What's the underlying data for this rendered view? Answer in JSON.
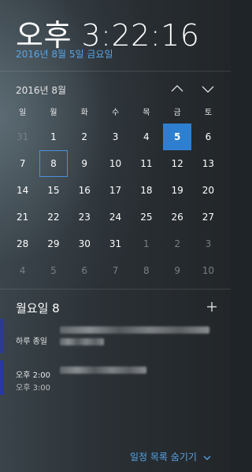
{
  "clock": {
    "time": "오후 3:22:16"
  },
  "date_link": "2016년 8월 5일 금요일",
  "calendar": {
    "month_label": "2016년 8월",
    "weekdays": [
      "일",
      "월",
      "화",
      "수",
      "목",
      "금",
      "토"
    ],
    "weeks": [
      [
        "31",
        "1",
        "2",
        "3",
        "4",
        "5",
        "6"
      ],
      [
        "7",
        "8",
        "9",
        "10",
        "11",
        "12",
        "13"
      ],
      [
        "14",
        "15",
        "16",
        "17",
        "18",
        "19",
        "20"
      ],
      [
        "21",
        "22",
        "23",
        "24",
        "25",
        "26",
        "27"
      ],
      [
        "28",
        "29",
        "30",
        "31",
        "1",
        "2",
        "3"
      ],
      [
        "4",
        "5",
        "6",
        "7",
        "8",
        "9",
        "10"
      ]
    ],
    "today": "5",
    "selected": "8",
    "accent_color": "#2f7fd1"
  },
  "agenda": {
    "title": "월요일 8",
    "add_icon": "plus-icon",
    "events": [
      {
        "time": "하루 종일",
        "end": "",
        "color": "#2e3a8c"
      },
      {
        "time": "오후 2:00",
        "end": "오후 3:00",
        "color": "#2936a5"
      }
    ]
  },
  "footer": {
    "hide_label": "일정 목록 숨기기"
  },
  "link_color": "#58a6e8"
}
